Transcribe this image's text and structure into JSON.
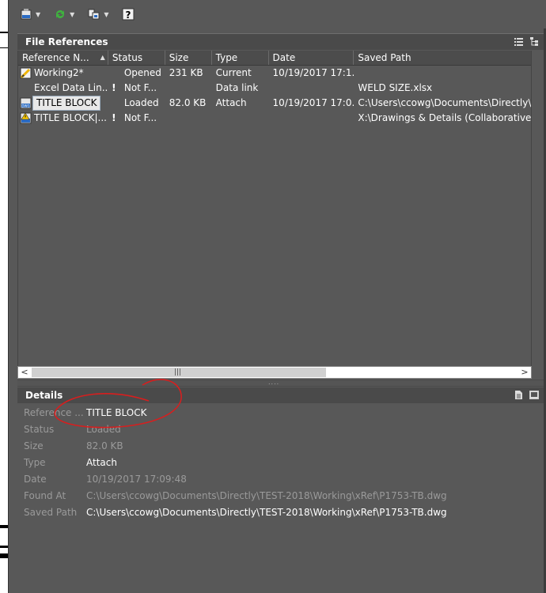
{
  "toolbar": {
    "items": [
      {
        "icon": "dwg-attach-icon",
        "has_dropdown": true
      },
      {
        "icon": "refresh-icon",
        "has_dropdown": true
      },
      {
        "icon": "change-path-icon",
        "has_dropdown": true
      },
      {
        "icon": "help-icon",
        "has_dropdown": false
      }
    ]
  },
  "file_references": {
    "title": "File References",
    "icons": [
      "list-view-icon",
      "tree-view-icon"
    ],
    "columns": [
      "Reference N...",
      "Status",
      "Size",
      "Type",
      "Date",
      "Saved Path"
    ],
    "rows": [
      {
        "name": "Working2*",
        "warning": "",
        "status": "Opened",
        "size": "231 KB",
        "type": "Current",
        "date": "10/19/2017 17:1...",
        "path": "",
        "icon": "current-drawing-icon",
        "selected": false
      },
      {
        "name": "Excel Data Lin...",
        "warning": "!",
        "status": "Not F...",
        "size": "",
        "type": "Data link",
        "date": "",
        "path": "WELD SIZE.xlsx",
        "icon": "",
        "selected": false
      },
      {
        "name": "TITLE BLOCK",
        "warning": "",
        "status": "Loaded",
        "size": "82.0 KB",
        "type": "Attach",
        "date": "10/19/2017 17:0...",
        "path": "C:\\Users\\ccowg\\Documents\\Directly\\TEST",
        "icon": "dwg-file-icon",
        "selected": true
      },
      {
        "name": "TITLE BLOCK|...",
        "warning": "!",
        "status": "Not F...",
        "size": "",
        "type": "",
        "date": "",
        "path": "X:\\Drawings & Details (Collaborative)\\Star",
        "icon": "dwg-warning-icon",
        "selected": false
      }
    ]
  },
  "details": {
    "title": "Details",
    "icons": [
      "details-view-icon",
      "preview-view-icon"
    ],
    "fields": [
      {
        "label": "Reference ...",
        "value": "TITLE BLOCK",
        "active": true
      },
      {
        "label": "Status",
        "value": "Loaded",
        "active": false
      },
      {
        "label": "Size",
        "value": "82.0 KB",
        "active": false
      },
      {
        "label": "Type",
        "value": "Attach",
        "active": true
      },
      {
        "label": "Date",
        "value": "10/19/2017 17:09:48",
        "active": false
      },
      {
        "label": "Found At",
        "value": "C:\\Users\\ccowg\\Documents\\Directly\\TEST-2018\\Working\\xRef\\P1753-TB.dwg",
        "active": false
      },
      {
        "label": "Saved Path",
        "value": "C:\\Users\\ccowg\\Documents\\Directly\\TEST-2018\\Working\\xRef\\P1753-TB.dwg",
        "active": true
      }
    ]
  },
  "colors": {
    "annotation": "#d81e1e",
    "background": "#585858",
    "header": "#4a4a4a"
  }
}
